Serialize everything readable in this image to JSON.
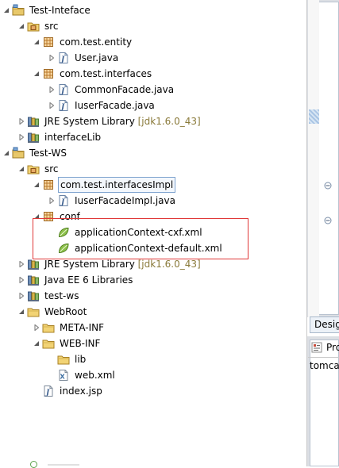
{
  "tree": [
    {
      "id": "test-inteface",
      "label": "Test-Inteface",
      "indent": 0,
      "twisty": "open",
      "icon": "project-icon"
    },
    {
      "id": "src-1",
      "label": "src",
      "indent": 1,
      "twisty": "open",
      "icon": "source-folder-icon"
    },
    {
      "id": "pkg-entity",
      "label": "com.test.entity",
      "indent": 2,
      "twisty": "open",
      "icon": "package-icon"
    },
    {
      "id": "user-java",
      "label": "User.java",
      "indent": 3,
      "twisty": "closed",
      "icon": "java-file-icon"
    },
    {
      "id": "pkg-interfaces",
      "label": "com.test.interfaces",
      "indent": 2,
      "twisty": "open",
      "icon": "package-icon"
    },
    {
      "id": "commonfacade-java",
      "label": "CommonFacade.java",
      "indent": 3,
      "twisty": "closed",
      "icon": "java-file-icon"
    },
    {
      "id": "iuserfacade-java",
      "label": "IuserFacade.java",
      "indent": 3,
      "twisty": "closed",
      "icon": "java-file-icon"
    },
    {
      "id": "jre-1",
      "label": "JRE System Library",
      "decoration": "[jdk1.6.0_43]",
      "indent": 1,
      "twisty": "closed",
      "icon": "library-icon"
    },
    {
      "id": "interfacelib",
      "label": "interfaceLib",
      "indent": 1,
      "twisty": "closed",
      "icon": "library-icon"
    },
    {
      "id": "test-ws",
      "label": "Test-WS",
      "indent": 0,
      "twisty": "open",
      "icon": "project-icon"
    },
    {
      "id": "src-2",
      "label": "src",
      "indent": 1,
      "twisty": "open",
      "icon": "source-folder-icon"
    },
    {
      "id": "pkg-interfacesimpl",
      "label": "com.test.interfacesImpl",
      "indent": 2,
      "twisty": "open",
      "icon": "package-icon",
      "selected": true
    },
    {
      "id": "iuserfacadeimpl-java",
      "label": "IuserFacadeImpl.java",
      "indent": 3,
      "twisty": "closed",
      "icon": "java-file-icon"
    },
    {
      "id": "conf",
      "label": "conf",
      "indent": 2,
      "twisty": "open",
      "icon": "package-icon"
    },
    {
      "id": "appctx-cxf",
      "label": "applicationContext-cxf.xml",
      "indent": 3,
      "twisty": "none",
      "icon": "spring-leaf-icon"
    },
    {
      "id": "appctx-default",
      "label": "applicationContext-default.xml",
      "indent": 3,
      "twisty": "none",
      "icon": "spring-leaf-icon"
    },
    {
      "id": "jre-2",
      "label": "JRE System Library",
      "decoration": "[jdk1.6.0_43]",
      "indent": 1,
      "twisty": "closed",
      "icon": "library-icon"
    },
    {
      "id": "javaee6",
      "label": "Java EE 6 Libraries",
      "indent": 1,
      "twisty": "closed",
      "icon": "library-icon"
    },
    {
      "id": "test-ws-lib",
      "label": "test-ws",
      "indent": 1,
      "twisty": "closed",
      "icon": "library-icon"
    },
    {
      "id": "webroot",
      "label": "WebRoot",
      "indent": 1,
      "twisty": "open",
      "icon": "folder-icon"
    },
    {
      "id": "meta-inf",
      "label": "META-INF",
      "indent": 2,
      "twisty": "closed",
      "icon": "folder-icon"
    },
    {
      "id": "web-inf",
      "label": "WEB-INF",
      "indent": 2,
      "twisty": "open",
      "icon": "folder-icon"
    },
    {
      "id": "lib",
      "label": "lib",
      "indent": 3,
      "twisty": "none",
      "icon": "folder-icon"
    },
    {
      "id": "web-xml",
      "label": "web.xml",
      "indent": 3,
      "twisty": "none",
      "icon": "xml-file-icon"
    },
    {
      "id": "index-jsp",
      "label": "index.jsp",
      "indent": 2,
      "twisty": "none",
      "icon": "jsp-file-icon"
    }
  ],
  "right": {
    "design_tab": "Desig",
    "problems_tab": "Pro",
    "console_text": "tomca"
  }
}
